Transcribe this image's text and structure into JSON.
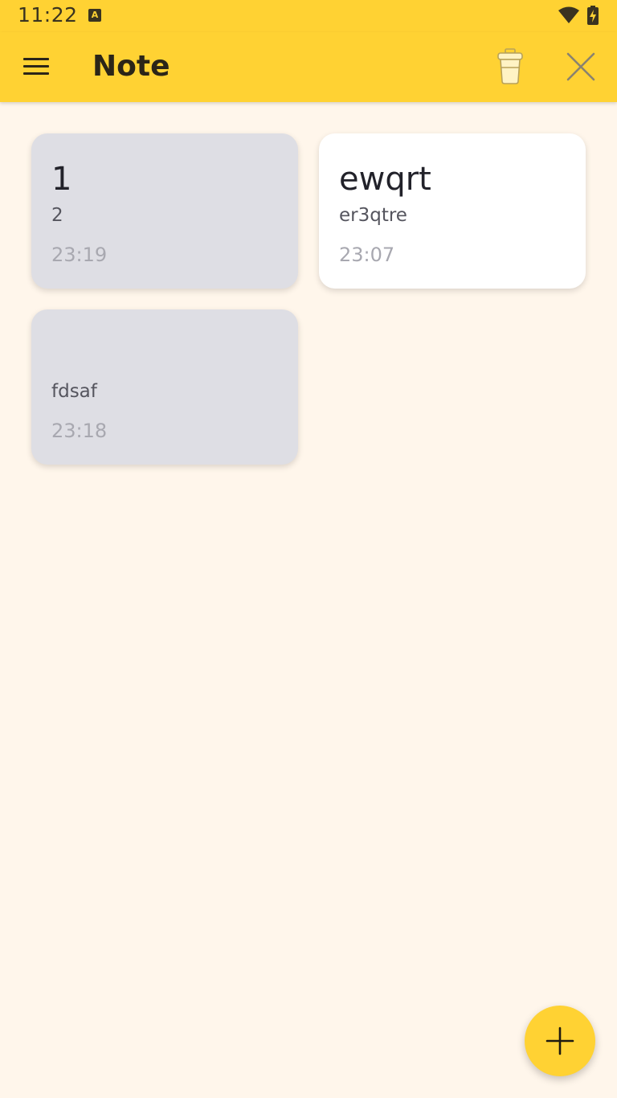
{
  "status_bar": {
    "time": "11:22",
    "notification_icon": "A"
  },
  "app_bar": {
    "title": "Note",
    "menu_icon": "hamburger-menu",
    "actions": [
      "trash-icon",
      "close-icon"
    ]
  },
  "notes": [
    {
      "title": "1",
      "body": "2",
      "time": "23:19",
      "selected": true
    },
    {
      "title": "ewqrt",
      "body": "er3qtre",
      "time": "23:07",
      "selected": false
    },
    {
      "title": "",
      "body": "fdsaf",
      "time": "23:18",
      "selected": true
    }
  ],
  "fab": {
    "icon": "plus-icon"
  },
  "colors": {
    "accent": "#FFD233",
    "background": "#FFF6EB",
    "selected_card": "#DEDEE4",
    "card": "#FFFFFF"
  }
}
